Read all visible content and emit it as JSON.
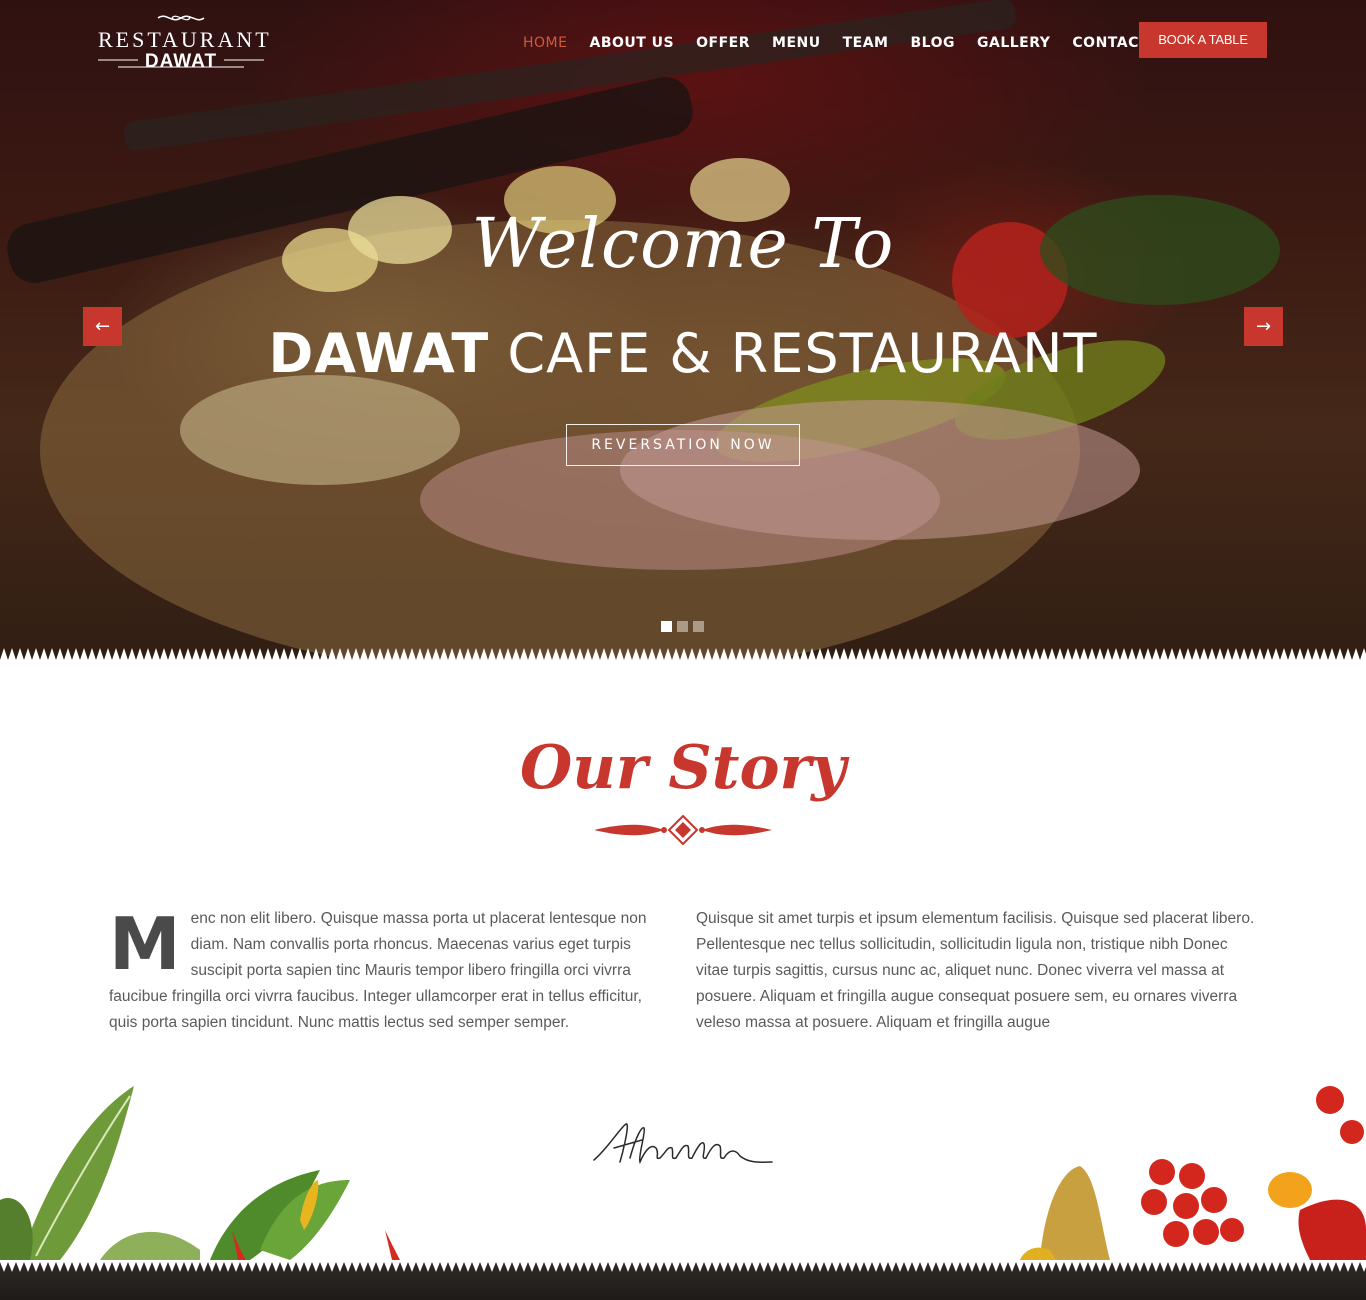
{
  "header": {
    "logo_top": "RESTAURANT",
    "logo_bottom": "DAWAT",
    "nav": [
      {
        "label": "HOME"
      },
      {
        "label": "ABOUT US"
      },
      {
        "label": "OFFER"
      },
      {
        "label": "MENU"
      },
      {
        "label": "TEAM"
      },
      {
        "label": "BLOG"
      },
      {
        "label": "GALLERY"
      },
      {
        "label": "CONTACT"
      }
    ],
    "active_nav": "HOME",
    "book_label": "BOOK A TABLE"
  },
  "hero": {
    "welcome": "Welcome To",
    "title_strong": "DAWAT",
    "title_light": "CAFE & RESTAURANT",
    "cta_label": "REVERSATION NOW",
    "prev_icon": "arrow-left-icon",
    "next_icon": "arrow-right-icon",
    "slide_count": 3,
    "active_slide": 1
  },
  "story": {
    "title": "Our Story",
    "dropcap": "M",
    "left_text": "enc non elit libero. Quisque massa porta ut placerat lentesque non diam. Nam convallis porta rhoncus. Maecenas varius eget turpis suscipit porta sapien tinc Mauris tempor libero fringilla orci vivrra faucibue fringilla orci vivrra faucibus. Integer ullamcorper erat in tellus efficitur, quis porta sapien tincidunt. Nunc mattis lectus sed semper semper.",
    "right_text": "Quisque sit amet turpis et ipsum elementum facilisis. Quisque sed placerat libero. Pellentesque nec tellus sollicitudin, sollicitudin ligula non, tristique nibh Donec vitae turpis sagittis, cursus nunc ac, aliquet nunc. Donec viverra vel massa at posuere. Aliquam et fringilla augue consequat posuere sem, eu ornares viverra veleso massa at posuere. Aliquam et fringilla augue"
  },
  "colors": {
    "accent": "#c8372d",
    "nav_active": "#d05a3a",
    "text": "#5a5a5a"
  }
}
